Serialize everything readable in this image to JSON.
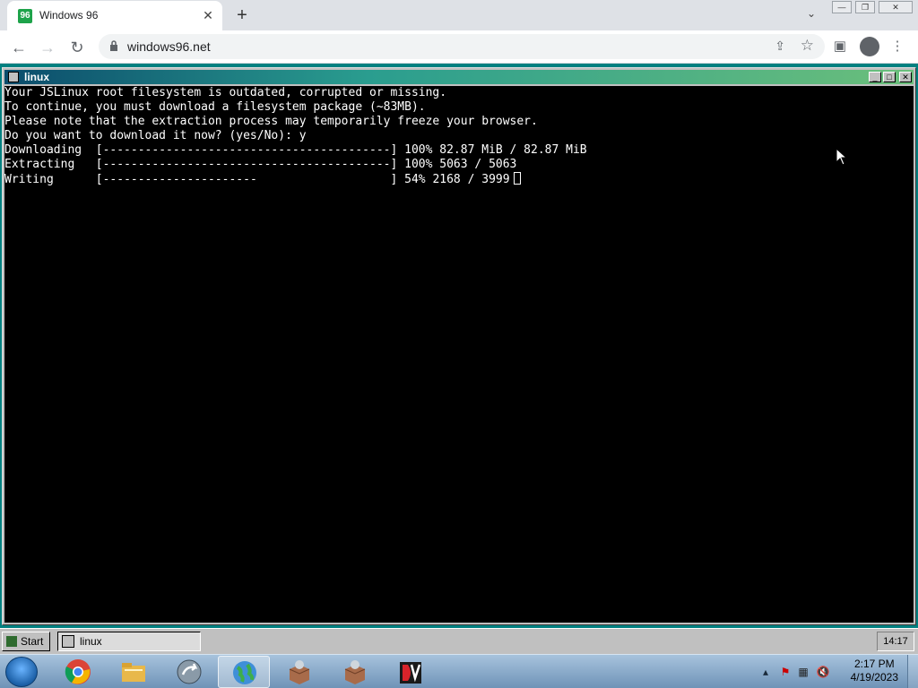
{
  "browser": {
    "tab_title": "Windows 96",
    "tab_favicon": "windows96-icon",
    "new_tab_label": "+",
    "url": "windows96.net",
    "window_controls": [
      "minimize-icon",
      "restore-icon",
      "close-icon"
    ]
  },
  "window": {
    "title": "linux",
    "controls": [
      "minimize-icon",
      "maximize-icon",
      "close-icon"
    ]
  },
  "terminal": {
    "lines": [
      "Your JSLinux root filesystem is outdated, corrupted or missing.",
      "To continue, you must download a filesystem package (~83MB).",
      "Please note that the extraction process may temporarily freeze your browser.",
      "Do you want to download it now? (yes/No): y"
    ],
    "progress": [
      {
        "label": "Downloading",
        "bar": "[-----------------------------------------]",
        "percent": "100%",
        "detail": "82.87 MiB / 82.87 MiB",
        "fraction": 1.0
      },
      {
        "label": "Extracting",
        "bar": "[-----------------------------------------]",
        "percent": "100%",
        "detail": "5063 / 5063",
        "fraction": 1.0
      },
      {
        "label": "Writing",
        "bar": "[----------------------                   ]",
        "percent": "54%",
        "detail": "2168 / 3999",
        "fraction": 0.54
      }
    ]
  },
  "win96_taskbar": {
    "start_label": "Start",
    "task_label": "linux",
    "clock": "14:17"
  },
  "win7_taskbar": {
    "pinned": [
      "chrome-icon",
      "folder-icon",
      "arrow-app-icon",
      "globe-icon",
      "package-icon",
      "package-icon",
      "dv-icon"
    ],
    "active_index": 3,
    "time": "2:17 PM",
    "date": "4/19/2023",
    "tray": [
      "show-hidden-icons-chevron",
      "action-center-error-icon",
      "network-icon",
      "volume-muted-icon"
    ]
  },
  "colors": {
    "terminal_bg": "#000000",
    "terminal_fg": "#ffffff",
    "win96_face": "#c0c0c0",
    "titlebar_start": "#0b4c6c",
    "titlebar_end": "#6bbf7b"
  }
}
